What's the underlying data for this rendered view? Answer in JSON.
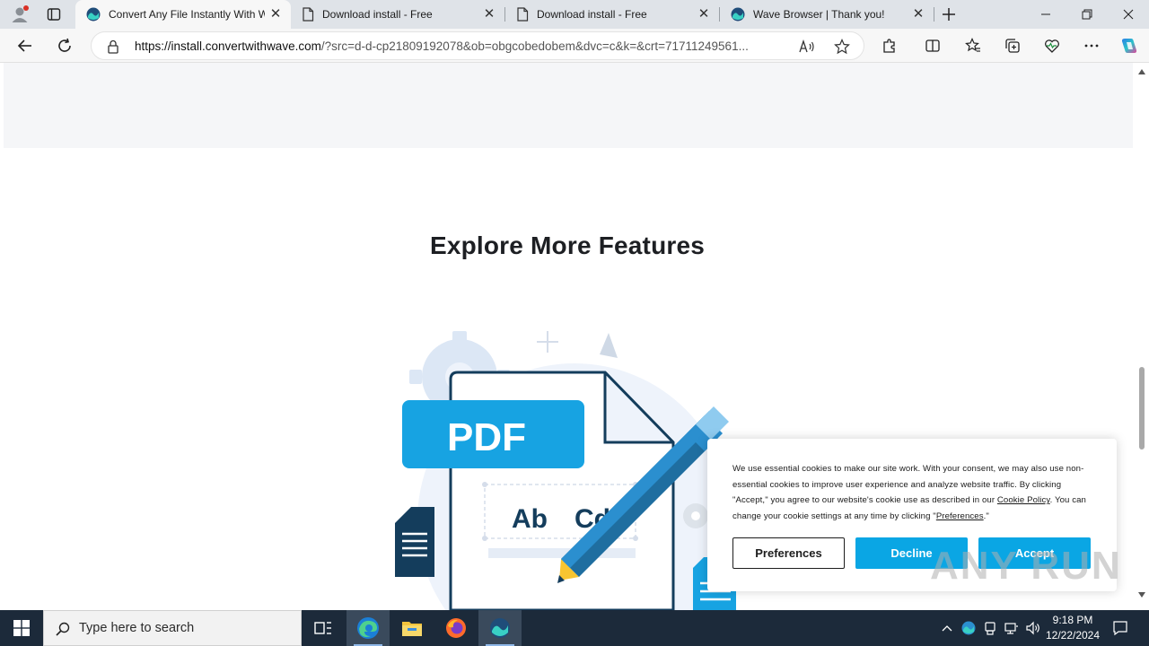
{
  "browser": {
    "tabs": [
      {
        "title": "Convert Any File Instantly With W",
        "active": true,
        "icon": "wave-logo-icon"
      },
      {
        "title": "Download install - Free",
        "active": false,
        "icon": "page-icon"
      },
      {
        "title": "Download install - Free",
        "active": false,
        "icon": "page-icon"
      },
      {
        "title": "Wave Browser | Thank you!",
        "active": false,
        "icon": "wave-logo-icon"
      }
    ],
    "url_host": "https://install.convertwithwave.com",
    "url_rest": "/?src=d-d-cp21809192078&ob=obgcobedobem&dvc=c&k=&crt=71711249561..."
  },
  "page": {
    "section_title": "Explore More Features",
    "illustration": {
      "pdf_label": "PDF",
      "text_sample_1": "Ab",
      "text_sample_2": "Cd"
    }
  },
  "cookie_banner": {
    "text_1": "We use essential cookies to make our site work. With your consent, we may also use non-essential cookies to improve user experience and analyze website traffic. By clicking \"Accept,\" you agree to our website's cookie use as described in our ",
    "cookie_policy_link": "Cookie Policy",
    "text_2": ". You can change your cookie settings at any time by clicking \"",
    "preferences_link": "Preferences",
    "text_3": ".\"",
    "preferences_button": "Preferences",
    "decline_button": "Decline",
    "accept_button": "Accept",
    "accent_color": "#0aa6e4"
  },
  "watermark": "ANY RUN",
  "taskbar": {
    "search_placeholder": "Type here to search",
    "time": "9:18 PM",
    "date": "12/22/2024"
  }
}
